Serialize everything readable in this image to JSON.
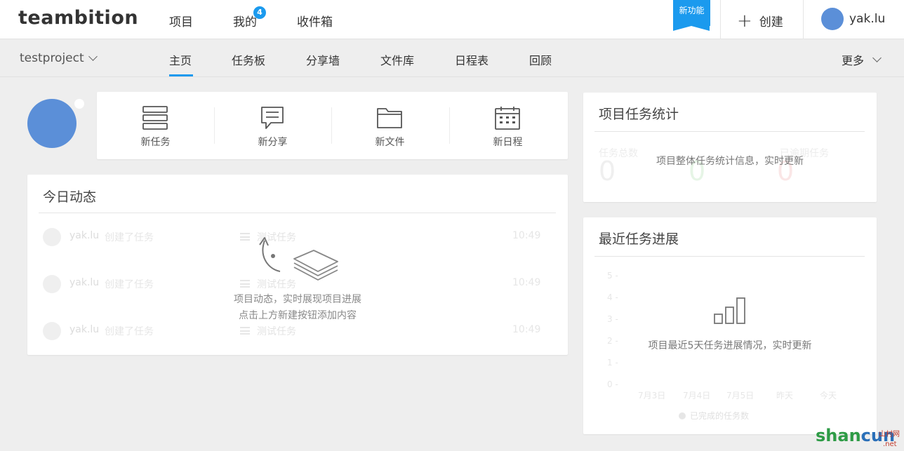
{
  "topbar": {
    "logo": "teambition",
    "nav": [
      "项目",
      "我的",
      "收件箱"
    ],
    "mine_badge": "4",
    "new_feature": "新功能",
    "create_label": "创建",
    "user_name": "yak.lu"
  },
  "subnav": {
    "project": "testproject",
    "tabs": [
      "主页",
      "任务板",
      "分享墙",
      "文件库",
      "日程表",
      "回顾"
    ],
    "active_tab": "主页",
    "more": "更多"
  },
  "quick_actions": [
    "新任务",
    "新分享",
    "新文件",
    "新日程"
  ],
  "activity": {
    "title": "今日动态",
    "sample_rows": [
      {
        "user": "yak.lu",
        "action": "创建了任务",
        "task": "测试任务",
        "time": "10:49"
      },
      {
        "user": "yak.lu",
        "action": "创建了任务",
        "task": "测试任务",
        "time": "10:49"
      },
      {
        "user": "yak.lu",
        "action": "创建了任务",
        "task": "测试任务",
        "time": "10:49"
      }
    ],
    "empty_line1": "项目动态，实时展现项目进展",
    "empty_line2": "点击上方新建按钮添加内容"
  },
  "stats": {
    "title": "项目任务统计",
    "labels": [
      "任务总数",
      "",
      "已逾期任务"
    ],
    "values": [
      "0",
      "0",
      "0"
    ],
    "message": "项目整体任务统计信息，实时更新"
  },
  "progress": {
    "title": "最近任务进展",
    "y_ticks": [
      "5 -",
      "4 -",
      "3 -",
      "2 -",
      "1 -",
      "0 -"
    ],
    "x_ticks": [
      "7月3日",
      "7月4日",
      "7月5日",
      "昨天",
      "今天"
    ],
    "legend": "已完成的任务数",
    "message": "项目最近5天任务进展情况，实时更新"
  },
  "watermark": {
    "text1": "shan",
    "text2": "cun",
    "sub": "山村网",
    "net": ".net"
  },
  "colors": {
    "accent": "#1b9aee",
    "avatar": "#5b8fd8",
    "background": "#eeeeee"
  }
}
